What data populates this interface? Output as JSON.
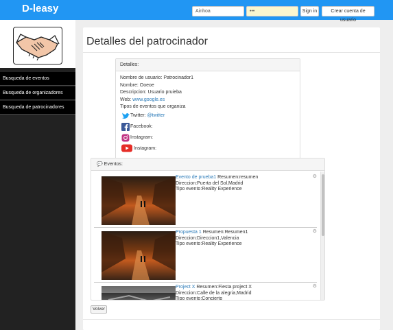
{
  "header": {
    "brand": "D-leasy",
    "username_value": "Ainhoa",
    "password_value": "•••",
    "signin_label": "Sign in",
    "register_label": "Crear cuenta de usuario",
    "accent": "#2196f3"
  },
  "sidebar": {
    "logo_icon": "handshake-icon",
    "items": [
      {
        "label": "Busqueda de eventos"
      },
      {
        "label": "Busqueda de organizadores"
      },
      {
        "label": "Busqueda de patrocinadores"
      }
    ]
  },
  "main": {
    "title": "Detalles del patrocinador",
    "details": {
      "heading": "Detalles:",
      "username": "Nombre de usuario: Patrocinador1",
      "name": "Nombre: Ooeoe",
      "description": "Descripcion: Usuario pruieba",
      "web_label": "Web:",
      "web_link": "www.google.es",
      "event_types": "Tipos de eventos que organiza",
      "twitter_label": "Twitter:",
      "twitter_link": "@twitter",
      "facebook_label": "Facebook:",
      "instagram_label": "Instagram:",
      "youtube_label": "Instagram:"
    },
    "events": {
      "heading": "Eventos:",
      "items": [
        {
          "title": "Evento de prueba1",
          "summary": "Resumen:resumen",
          "address": "Direccion:Puerta del Sol,Madrid",
          "type": "Tipo evento:Reality Experience"
        },
        {
          "title": "Propuesta 1",
          "summary": "Resumen:Resumen1",
          "address": "Direccion:Direccion1,Valencia",
          "type": "Tipo evento:Reality Experience"
        },
        {
          "title": "Project X",
          "summary": "Resumen:Fiesta project X",
          "address": "Direccion:Calle de la alegria,Madrid",
          "type": "Tipo evento:Concierto"
        }
      ]
    },
    "back_label": "Volver"
  }
}
